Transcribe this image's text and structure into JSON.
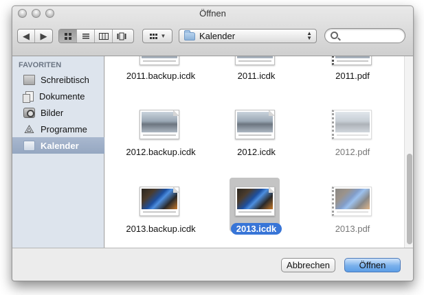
{
  "window": {
    "title": "Öffnen"
  },
  "toolbar": {
    "back_icon": "chevron-left-icon",
    "forward_icon": "chevron-right-icon",
    "view_modes": [
      {
        "name": "icon-view",
        "active": true
      },
      {
        "name": "list-view",
        "active": false
      },
      {
        "name": "column-view",
        "active": false
      },
      {
        "name": "coverflow-view",
        "active": false
      }
    ],
    "arrange_icon": "arrange-grid-icon",
    "location": "Kalender",
    "search": {
      "value": "",
      "placeholder": ""
    }
  },
  "sidebar": {
    "heading": "FAVORITEN",
    "items": [
      {
        "label": "Schreibtisch",
        "icon": "desktop-icon",
        "selected": false
      },
      {
        "label": "Dokumente",
        "icon": "documents-icon",
        "selected": false
      },
      {
        "label": "Bilder",
        "icon": "camera-icon",
        "selected": false
      },
      {
        "label": "Programme",
        "icon": "applications-icon",
        "selected": false
      },
      {
        "label": "Kalender",
        "icon": "folder-icon",
        "selected": true
      }
    ]
  },
  "files": [
    {
      "name": "2011.backup.icdk",
      "enabled": true,
      "selected": false
    },
    {
      "name": "2011.icdk",
      "enabled": true,
      "selected": false
    },
    {
      "name": "2011.pdf",
      "enabled": true,
      "selected": false
    },
    {
      "name": "2012.backup.icdk",
      "enabled": true,
      "selected": false
    },
    {
      "name": "2012.icdk",
      "enabled": true,
      "selected": false
    },
    {
      "name": "2012.pdf",
      "enabled": false,
      "selected": false
    },
    {
      "name": "2013.backup.icdk",
      "enabled": true,
      "selected": false
    },
    {
      "name": "2013.icdk",
      "enabled": true,
      "selected": true
    },
    {
      "name": "2013.pdf",
      "enabled": false,
      "selected": false
    }
  ],
  "buttons": {
    "cancel": "Abbrechen",
    "open": "Öffnen"
  },
  "colors": {
    "selection": "#3875d7",
    "sidebar_bg": "#dde4ed",
    "primary_button": "#79b0ec"
  }
}
